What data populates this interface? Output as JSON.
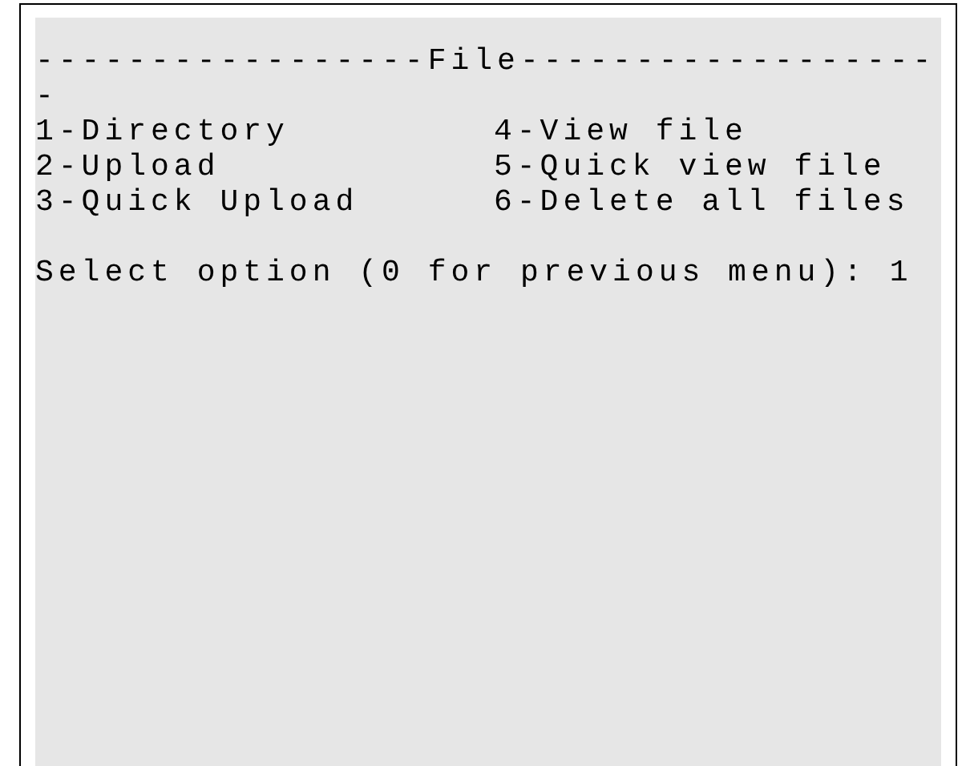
{
  "header": {
    "rule": "-----------------File------------------",
    "wrap": "-"
  },
  "options": [
    "1-Directory",
    "4-View file",
    "2-Upload",
    "5-Quick view file",
    "3-Quick Upload",
    "6-Delete all files"
  ],
  "prompt": "Select option (0 for previous menu): 1"
}
